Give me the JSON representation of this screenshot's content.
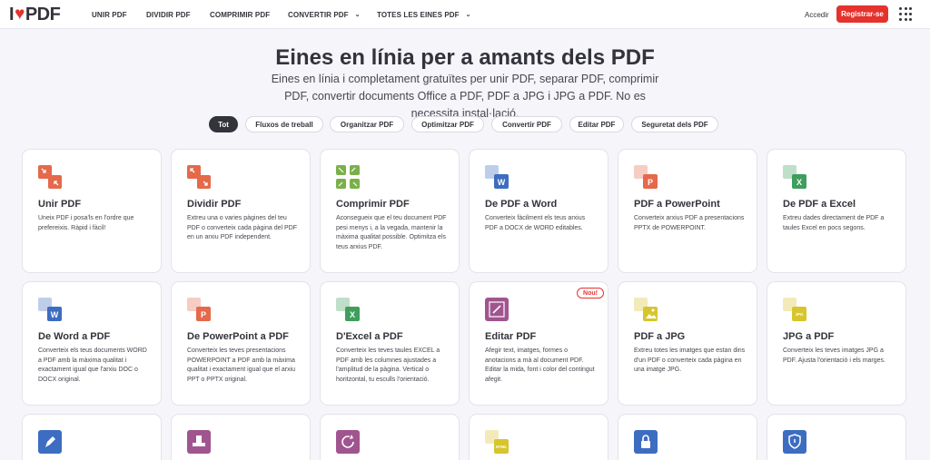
{
  "header": {
    "logo_left": "I",
    "logo_right": "PDF",
    "nav": [
      {
        "label": "UNIR PDF",
        "dropdown": false
      },
      {
        "label": "DIVIDIR PDF",
        "dropdown": false
      },
      {
        "label": "COMPRIMIR PDF",
        "dropdown": false
      },
      {
        "label": "CONVERTIR PDF",
        "dropdown": true
      },
      {
        "label": "TOTES LES EINES PDF",
        "dropdown": true
      }
    ],
    "login": "Accedir",
    "register": "Registrar-se"
  },
  "hero": {
    "title": "Eines en línia per a amants dels PDF",
    "subtitle": "Eines en línia i completament gratuïtes per unir PDF, separar PDF, comprimir PDF, convertir documents Office a PDF, PDF a JPG i JPG a PDF. No es necessita instal·lació."
  },
  "filters": [
    {
      "label": "Tot",
      "active": true
    },
    {
      "label": "Fluxos de treball",
      "active": false
    },
    {
      "label": "Organitzar PDF",
      "active": false
    },
    {
      "label": "Optimitzar PDF",
      "active": false
    },
    {
      "label": "Convertir PDF",
      "active": false
    },
    {
      "label": "Editar PDF",
      "active": false
    },
    {
      "label": "Seguretat dels PDF",
      "active": false
    }
  ],
  "tools": [
    {
      "title": "Unir PDF",
      "desc": "Uneix PDF i posa'ls en l'ordre que prefereixis. Ràpid i fàcil!",
      "icon": "merge-icon",
      "color": "#e5694a"
    },
    {
      "title": "Dividir PDF",
      "desc": "Extreu una o varies pàgines del teu PDF o converteix cada pàgina del PDF en un arxiu PDF independent.",
      "icon": "split-icon",
      "color": "#e5694a"
    },
    {
      "title": "Comprimir PDF",
      "desc": "Aconsegueix que el teu document PDF pesi menys i, a la vegada, mantenir la màxima qualitat possible. Optimitza els teus arxius PDF.",
      "icon": "compress-icon",
      "color": "#7ab04a"
    },
    {
      "title": "De PDF a Word",
      "desc": "Converteix fàcilment els teus arxius PDF a DOCX de WORD editables.",
      "icon": "pdf-to-word-icon",
      "color": "#3d6dc0",
      "letter": "W"
    },
    {
      "title": "PDF a PowerPoint",
      "desc": "Converteix arxius PDF a presentacions PPTX de POWERPOINT.",
      "icon": "pdf-to-powerpoint-icon",
      "color": "#e5694a",
      "letter": "P"
    },
    {
      "title": "De PDF a Excel",
      "desc": "Extreu dades directament de PDF a taules Excel en pocs segons.",
      "icon": "pdf-to-excel-icon",
      "color": "#3f9e5c",
      "letter": "X"
    },
    {
      "title": "De Word a PDF",
      "desc": "Converteix els teus documents WORD a PDF amb la màxima qualitat i exactament igual que l'arxiu DOC o DOCX original.",
      "icon": "word-to-pdf-icon",
      "color": "#3d6dc0",
      "letter": "W"
    },
    {
      "title": "De PowerPoint a PDF",
      "desc": "Converteix les teves presentacions POWERPOINT a PDF amb la màxima qualitat i exactament igual que el arxiu PPT o PPTX original.",
      "icon": "powerpoint-to-pdf-icon",
      "color": "#e5694a",
      "letter": "P"
    },
    {
      "title": "D'Excel a PDF",
      "desc": "Converteix les teves taules EXCEL a PDF amb les columnes ajustades a l'amplitud de la pàgina. Vertical o horitzontal, tu esculls l'orientació.",
      "icon": "excel-to-pdf-icon",
      "color": "#3f9e5c",
      "letter": "X"
    },
    {
      "title": "Editar PDF",
      "desc": "Afegir text, imatges, formes o anotacions a mà al document PDF. Editar la mida, font i color del contingut afegit.",
      "icon": "edit-icon",
      "color": "#a0558f",
      "badge": "Nou!"
    },
    {
      "title": "PDF a JPG",
      "desc": "Extreu totes les imatges que estan dins d'un PDF o converteix cada pàgina en una imatge JPG.",
      "icon": "pdf-to-jpg-icon",
      "color": "#d8c42e"
    },
    {
      "title": "JPG a PDF",
      "desc": "Converteix les teves imatges JPG a PDF. Ajusta l'orientació i els marges.",
      "icon": "jpg-to-pdf-icon",
      "color": "#d8c42e",
      "letter": "JPG"
    },
    {
      "title": "",
      "desc": "",
      "icon": "sign-icon",
      "color": "#3d6dc0"
    },
    {
      "title": "",
      "desc": "",
      "icon": "stamp-icon",
      "color": "#a0558f"
    },
    {
      "title": "",
      "desc": "",
      "icon": "rotate-icon",
      "color": "#a0558f"
    },
    {
      "title": "",
      "desc": "",
      "icon": "html-to-pdf-icon",
      "color": "#d8c42e",
      "letter": "HTML"
    },
    {
      "title": "",
      "desc": "",
      "icon": "lock-icon",
      "color": "#3d6dc0"
    },
    {
      "title": "",
      "desc": "",
      "icon": "shield-icon",
      "color": "#3d6dc0"
    }
  ]
}
